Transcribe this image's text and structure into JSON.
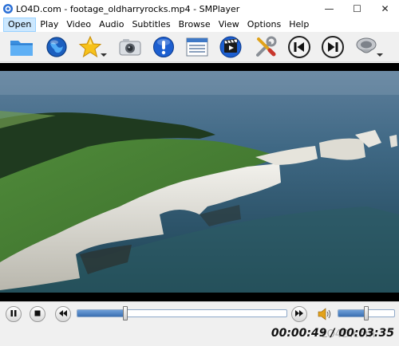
{
  "window": {
    "title": "LO4D.com - footage_oldharryrocks.mp4 - SMPlayer",
    "controls": {
      "minimize": "—",
      "maximize": "☐",
      "close": "✕"
    }
  },
  "menu": {
    "items": [
      {
        "label": "Open",
        "active": true
      },
      {
        "label": "Play"
      },
      {
        "label": "Video"
      },
      {
        "label": "Audio"
      },
      {
        "label": "Subtitles"
      },
      {
        "label": "Browse"
      },
      {
        "label": "View"
      },
      {
        "label": "Options"
      },
      {
        "label": "Help"
      }
    ]
  },
  "toolbar": {
    "buttons": [
      {
        "name": "open-folder",
        "icon": "folder-icon"
      },
      {
        "name": "open-url",
        "icon": "globe-icon"
      },
      {
        "name": "favorites",
        "icon": "star-icon",
        "dropdown": true
      },
      {
        "name": "screenshot",
        "icon": "camera-icon"
      },
      {
        "name": "info",
        "icon": "info-icon"
      },
      {
        "name": "playlist",
        "icon": "playlist-icon"
      },
      {
        "name": "play-media",
        "icon": "clapperboard-icon"
      },
      {
        "name": "preferences",
        "icon": "tools-icon"
      },
      {
        "name": "previous",
        "icon": "previous-icon"
      },
      {
        "name": "next",
        "icon": "next-icon"
      },
      {
        "name": "audio-device",
        "icon": "speaker-icon",
        "dropdown": true
      }
    ]
  },
  "playback": {
    "progress": 0.23,
    "volume": 0.5,
    "time_display": "00:00:49 / 00:03:35",
    "colors": {
      "seek_fill": "#3a6fb2"
    }
  },
  "watermark": {
    "text": "LO4D.com"
  }
}
